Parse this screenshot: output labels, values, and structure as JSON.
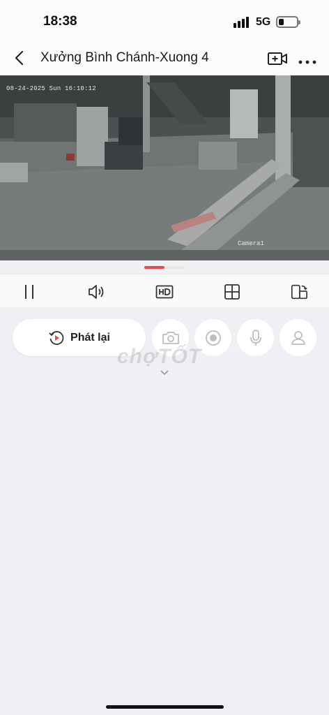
{
  "status_bar": {
    "time": "18:38",
    "network": "5G"
  },
  "header": {
    "title": "Xưởng Bình Chánh-Xuong 4"
  },
  "video": {
    "osd_datetime": "08-24-2025 Sun 16:10:12",
    "osd_camera": "Camera1"
  },
  "controls": [
    "pause-icon",
    "volume-icon",
    "hd-icon",
    "grid-icon",
    "rotate-screen-icon"
  ],
  "actions": {
    "replay_label": "Phát lại"
  },
  "watermark": "chợTỐT",
  "colors": {
    "accent": "#e84a4a",
    "background": "#f0eff4"
  }
}
